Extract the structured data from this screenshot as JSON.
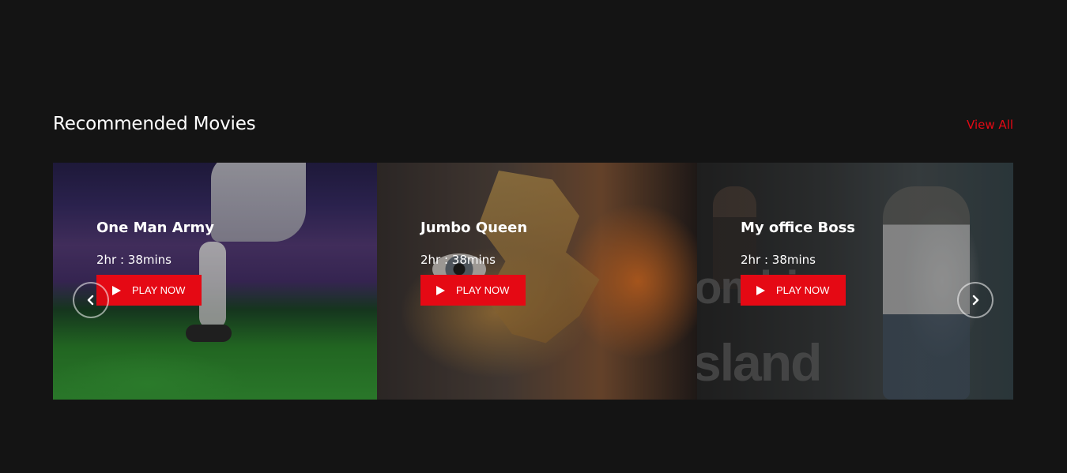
{
  "section": {
    "title": "Recommended Movies",
    "view_all": "View All"
  },
  "movies": [
    {
      "title": "One Man Army",
      "duration": "2hr : 38mins",
      "play_label": "PLAY NOW",
      "icon": "play-icon"
    },
    {
      "title": "Jumbo Queen",
      "duration": "2hr : 38mins",
      "play_label": "PLAY NOW",
      "icon": "play-icon"
    },
    {
      "title": "My office Boss",
      "duration": "2hr : 38mins",
      "play_label": "PLAY NOW",
      "icon": "play-icon",
      "poster_text": [
        "ombie",
        "sland"
      ]
    }
  ],
  "navigation": {
    "prev_icon": "chevron-left-icon",
    "next_icon": "chevron-right-icon"
  },
  "colors": {
    "background": "#141414",
    "accent": "#e50914",
    "text": "#ffffff"
  }
}
